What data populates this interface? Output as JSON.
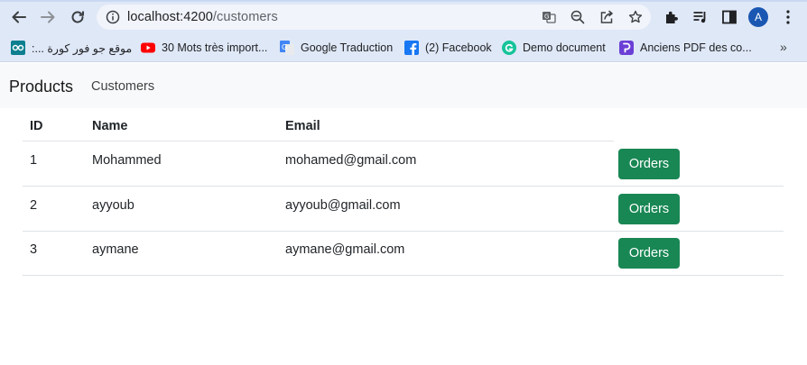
{
  "browser": {
    "url_host": "localhost:4200",
    "url_path": "/customers",
    "profile_initial": "A",
    "bookmarks": [
      {
        "label": "موقع جو فور كورة ...:",
        "icon": "goo-icon"
      },
      {
        "label": "30 Mots très import...",
        "icon": "youtube-icon"
      },
      {
        "label": "Google Traduction",
        "icon": "google-translate-icon"
      },
      {
        "label": "(2) Facebook",
        "icon": "facebook-icon"
      },
      {
        "label": "Demo document",
        "icon": "grammarly-icon"
      },
      {
        "label": "Anciens PDF des co...",
        "icon": "pdf-icon"
      }
    ],
    "more_bookmarks": "»"
  },
  "navbar": {
    "brand": "Products",
    "links": [
      "Customers"
    ]
  },
  "table": {
    "columns": [
      "ID",
      "Name",
      "Email"
    ],
    "rows": [
      {
        "id": "1",
        "name": "Mohammed",
        "email": "mohamed@gmail.com",
        "action": "Orders"
      },
      {
        "id": "2",
        "name": "ayyoub",
        "email": "ayyoub@gmail.com",
        "action": "Orders"
      },
      {
        "id": "3",
        "name": "aymane",
        "email": "aymane@gmail.com",
        "action": "Orders"
      }
    ]
  },
  "colors": {
    "chrome_bg": "#dfe8f7",
    "navbar_bg": "#f8f9fa",
    "success_button": "#198754",
    "avatar_bg": "#1a57b3"
  }
}
